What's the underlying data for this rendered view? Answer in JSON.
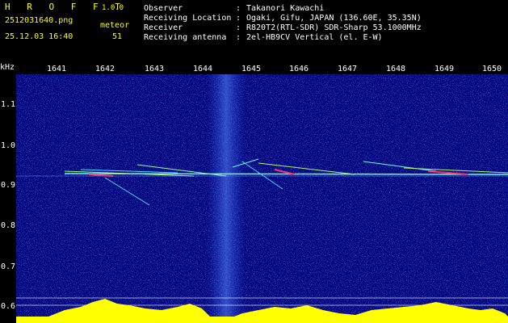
{
  "app": {
    "logo": "H R O F F T",
    "version": "1.0.0"
  },
  "file": {
    "name": "2512031640.png",
    "datetime": "25.12.03 16:40"
  },
  "meteor": {
    "label": "meteor",
    "count": "51"
  },
  "info": [
    {
      "key": "Observer",
      "sep": ":",
      "value": "Takanori Kawachi"
    },
    {
      "key": "Receiving Location",
      "sep": ":",
      "value": "Ogaki, Gifu, JAPAN (136.60E, 35.35N)"
    },
    {
      "key": "Receiver",
      "sep": ":",
      "value": "R820T2(RTL-SDR) SDR-Sharp 53.1000MHz"
    },
    {
      "key": "Receiving antenna",
      "sep": ":",
      "value": "2el-HB9CV Vertical (el. E-W)"
    }
  ],
  "axis": {
    "unit": "kHz",
    "time_labels": [
      "1641",
      "1642",
      "1643",
      "1644",
      "1645",
      "1646",
      "1647",
      "1648",
      "1649",
      "1650"
    ],
    "freq_labels": [
      "1.1",
      "1.0",
      "0.9",
      "0.8",
      "0.7",
      "0.6"
    ]
  },
  "colors": {
    "background": "#00008b",
    "text": "#ffffff",
    "accent": "#ffff00",
    "trace": "#55ffdd"
  }
}
